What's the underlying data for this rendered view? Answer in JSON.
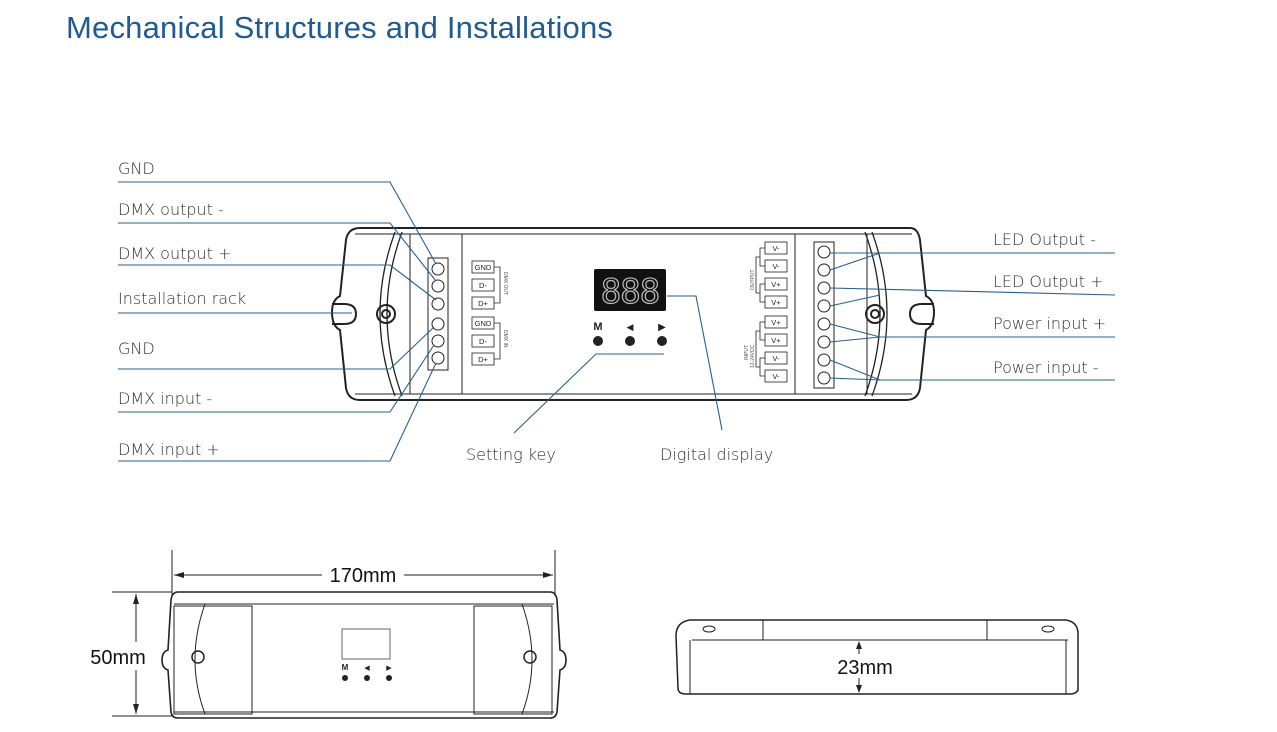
{
  "page_title": "Mechanical Structures and Installations",
  "left_labels": [
    "GND",
    "DMX output -",
    "DMX output +",
    "Installation rack",
    "GND",
    "DMX input -",
    "DMX input +"
  ],
  "right_labels": [
    "LED Output -",
    "LED Output +",
    "Power input +",
    "Power input -"
  ],
  "bottom_labels": {
    "setting_key": "Setting key",
    "digital_display": "Digital display"
  },
  "display": {
    "digits": "888"
  },
  "keys": {
    "m": "M",
    "left": "◀",
    "right": "▶"
  },
  "dmx_terminals": {
    "out_group": "DMX OUT",
    "in_group": "DMX IN",
    "out": [
      "GND",
      "D-",
      "D+"
    ],
    "in": [
      "GND",
      "D-",
      "D+"
    ]
  },
  "power_terminals": {
    "output_group": "OUTPUT",
    "input_group": "INPUT",
    "input_voltage": "12-24VDC",
    "labels": [
      "V-",
      "V-",
      "V+",
      "V+",
      "V+",
      "V+",
      "V-",
      "V-"
    ]
  },
  "dimensions": {
    "length": "170mm",
    "width": "50mm",
    "height": "23mm"
  },
  "colors": {
    "title": "#1f5a94",
    "leader": "#2a5f8f"
  }
}
